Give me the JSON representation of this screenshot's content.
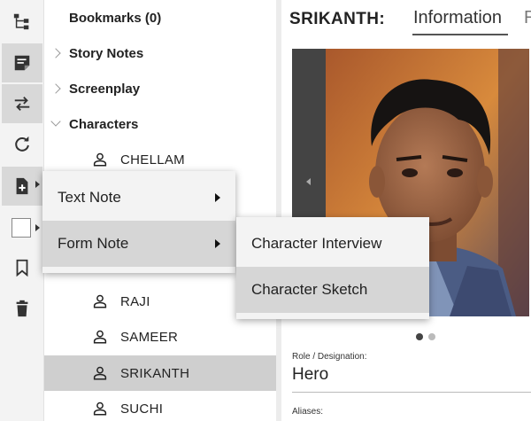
{
  "toolbar": {
    "buttons": [
      {
        "icon": "tree-structure-icon"
      },
      {
        "icon": "note-icon"
      },
      {
        "icon": "swap-arrows-icon"
      },
      {
        "icon": "refresh-icon"
      },
      {
        "icon": "add-document-icon"
      },
      {
        "icon": "color-swatch"
      },
      {
        "icon": "bookmark-icon"
      },
      {
        "icon": "trash-icon"
      }
    ]
  },
  "tree": {
    "bookmarks": "Bookmarks (0)",
    "story_notes": "Story Notes",
    "screenplay": "Screenplay",
    "characters": "Characters",
    "character_items": [
      "CHELLAM",
      "RAJI",
      "SAMEER",
      "SRIKANTH",
      "SUCHI"
    ],
    "selected": "SRIKANTH"
  },
  "detail": {
    "title": "SRIKANTH:",
    "tab_active": "Information",
    "tab_next": "R",
    "role_label": "Role / Designation:",
    "role_value": "Hero",
    "aliases_label": "Aliases:",
    "carousel_dots": 2,
    "carousel_active": 1
  },
  "context_menu": {
    "items": [
      "Text Note",
      "Form Note"
    ],
    "hovered": "Form Note",
    "submenu": [
      "Character Interview",
      "Character Sketch"
    ],
    "submenu_hovered": "Character Sketch"
  },
  "colors": {
    "toolbar_bg": "#f3f3f3",
    "selected_row": "#cfcfcf",
    "menu_bg": "#f3f3f3",
    "menu_hover": "#d6d6d6"
  }
}
